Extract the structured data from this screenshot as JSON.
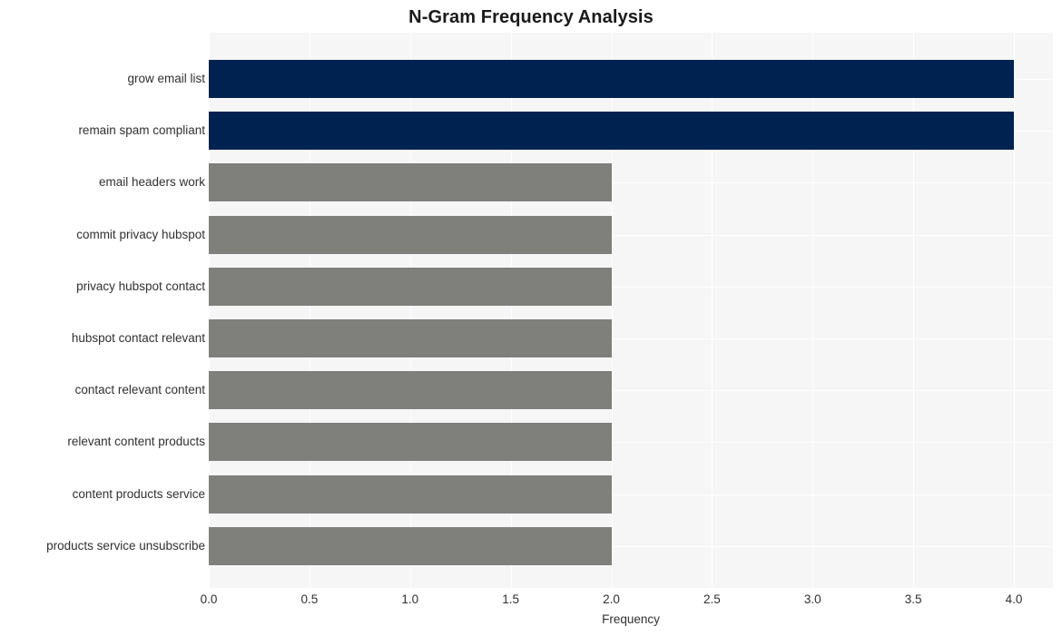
{
  "chart_data": {
    "type": "bar",
    "orientation": "horizontal",
    "title": "N-Gram Frequency Analysis",
    "xlabel": "Frequency",
    "ylabel": "",
    "categories": [
      "grow email list",
      "remain spam compliant",
      "email headers work",
      "commit privacy hubspot",
      "privacy hubspot contact",
      "hubspot contact relevant",
      "contact relevant content",
      "relevant content products",
      "content products service",
      "products service unsubscribe"
    ],
    "values": [
      4,
      4,
      2,
      2,
      2,
      2,
      2,
      2,
      2,
      2
    ],
    "bar_colors": [
      "#002251",
      "#002251",
      "#7f7f7c",
      "#7f7f7c",
      "#7f7f7c",
      "#7f7f7c",
      "#7f7f7c",
      "#7f7f7c",
      "#7f7f7c",
      "#7f7f7c"
    ],
    "xlim": [
      0.0,
      4.0
    ],
    "xticks": [
      "0.0",
      "0.5",
      "1.0",
      "1.5",
      "2.0",
      "2.5",
      "3.0",
      "3.5",
      "4.0"
    ],
    "xtick_values": [
      0.0,
      0.5,
      1.0,
      1.5,
      2.0,
      2.5,
      3.0,
      3.5,
      4.0
    ],
    "grid": true,
    "grid_color": "#ffffff",
    "plot_background": "#f6f6f6",
    "figure_background": "#ffffff",
    "legend": null,
    "highlight_color": "#002251",
    "default_color": "#7f7f7c"
  }
}
